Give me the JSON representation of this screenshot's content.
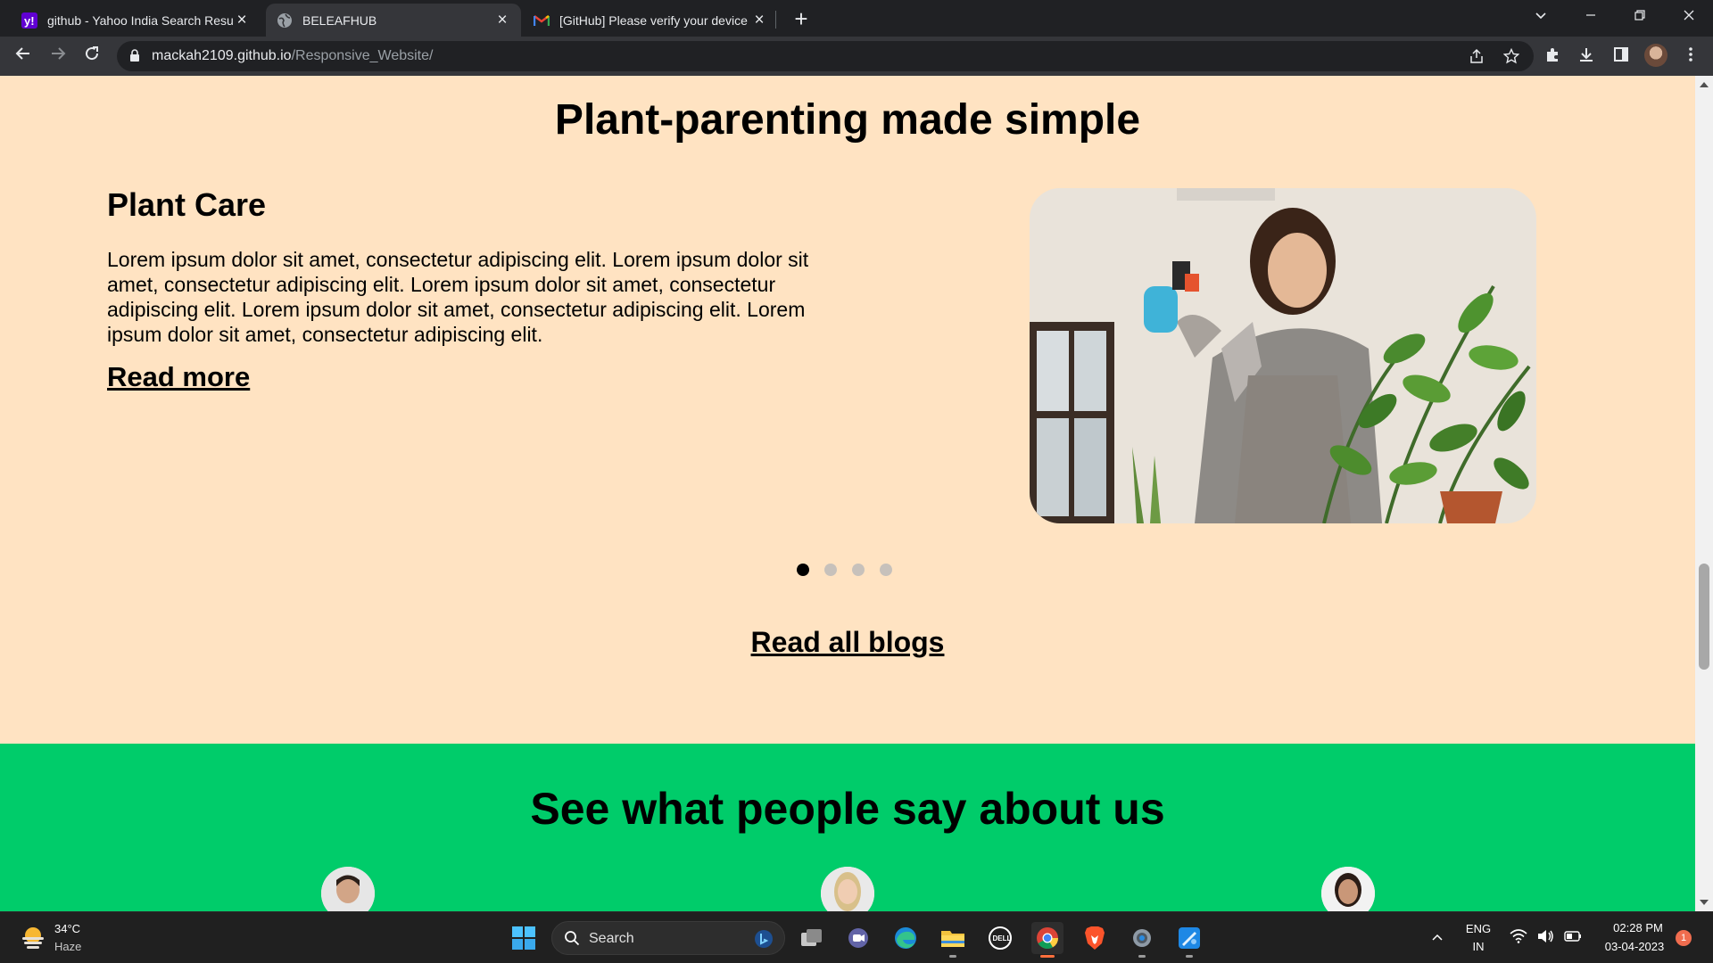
{
  "browser": {
    "tabs": [
      {
        "title": "github - Yahoo India Search Resu",
        "favicon": "yahoo-icon"
      },
      {
        "title": "BELEAFHUB",
        "favicon": "globe-icon",
        "active": true
      },
      {
        "title": "[GitHub] Please verify your device",
        "favicon": "gmail-icon"
      }
    ],
    "url_host": "mackah2109.github.io",
    "url_path": "/Responsive_Website/"
  },
  "page": {
    "blog_heading": "Plant-parenting made simple",
    "card": {
      "title": "Plant Care",
      "text": "Lorem ipsum dolor sit amet, consectetur adipiscing elit. Lorem ipsum dolor sit amet, consectetur adipiscing elit. Lorem ipsum dolor sit amet, consectetur adipiscing elit. Lorem ipsum dolor sit amet, consectetur adipiscing elit. Lorem ipsum dolor sit amet, consectetur adipiscing elit.",
      "read_more": "Read more"
    },
    "carousel": {
      "slides": 4,
      "active_index": 0
    },
    "read_all": "Read all blogs",
    "testimonials_heading": "See what people say about us",
    "colors": {
      "background": "#ffe3c2",
      "testimonials": "#00cc6a"
    }
  },
  "taskbar": {
    "weather_temp": "34°C",
    "weather_desc": "Haze",
    "search_label": "Search",
    "lang_top": "ENG",
    "lang_bottom": "IN",
    "time": "02:28 PM",
    "date": "03-04-2023",
    "notification_count": "1"
  }
}
